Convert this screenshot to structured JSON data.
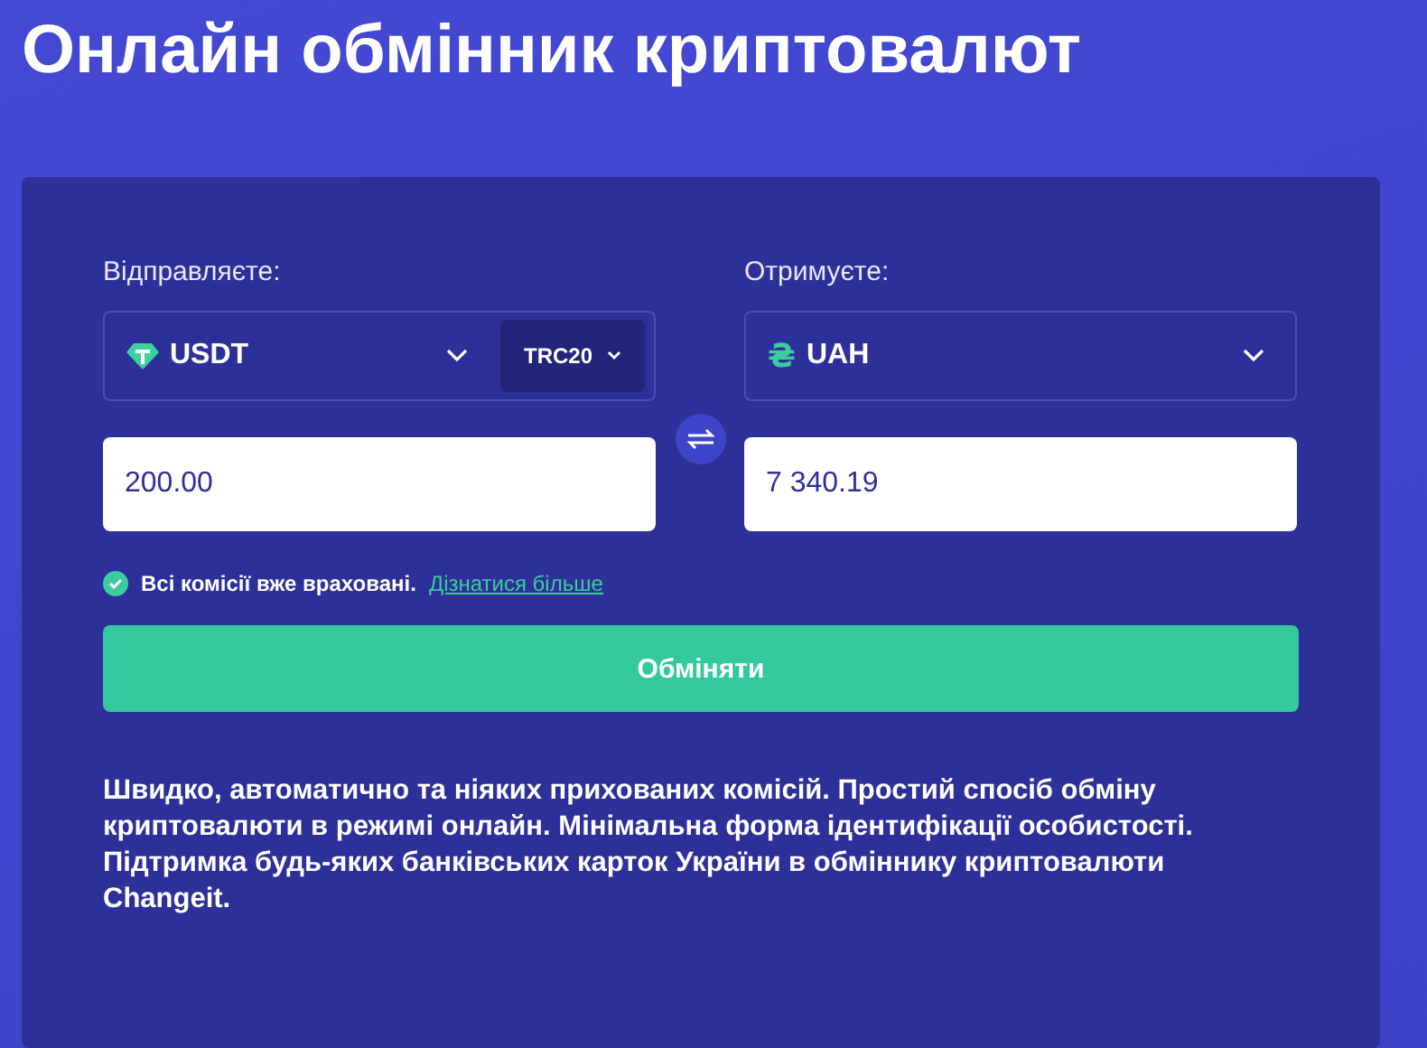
{
  "title": "Онлайн обмінник криптовалют",
  "send": {
    "label": "Відправляєте:",
    "currency": "USDT",
    "network": "TRC20",
    "amount": "200.00"
  },
  "receive": {
    "label": "Отримуєте:",
    "currency": "UAH",
    "symbol": "₴",
    "amount": "7 340.19"
  },
  "fees_note": {
    "text": "Всі комісії вже враховані.",
    "link": "Дізнатися більше",
    "checked": true
  },
  "exchange_button": "Обміняти",
  "description": "Швидко, автоматично та ніяких прихованих комісій. Простий спосіб обміну криптовалюти в режимі онлайн. Мінімальна форма ідентифікації особистості. Підтримка будь-яких банківських карток України в обміннику криптовалюти Changeit."
}
